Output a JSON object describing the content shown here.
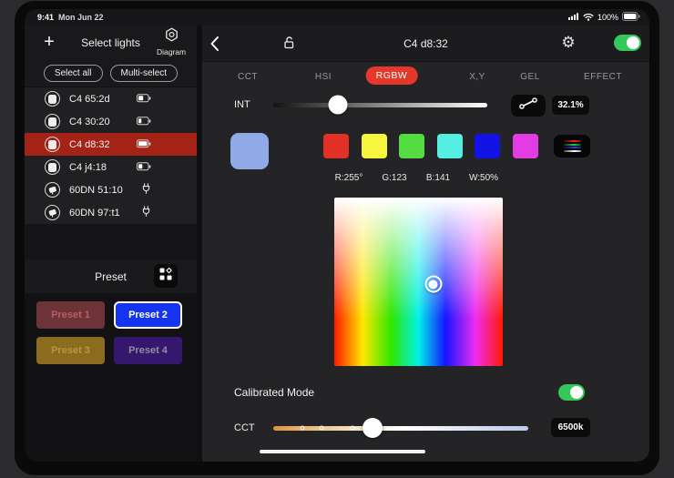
{
  "status_bar": {
    "time": "9:41",
    "date": "Mon Jun 22",
    "battery": "100%"
  },
  "icons": {
    "gear": "⚙",
    "plus": "+"
  },
  "sidebar": {
    "title": "Select lights",
    "diagram_label": "Diagram",
    "select_all": "Select all",
    "multi_select": "Multi-select",
    "lights": [
      {
        "name": "C4 65:2d",
        "type": "panel",
        "power": "battery",
        "battery_level": 55,
        "selected": false
      },
      {
        "name": "C4 30:20",
        "type": "panel",
        "power": "battery",
        "battery_level": 35,
        "selected": false
      },
      {
        "name": "C4 d8:32",
        "type": "panel",
        "power": "battery",
        "battery_level": 100,
        "selected": true
      },
      {
        "name": "C4 j4:18",
        "type": "panel",
        "power": "battery",
        "battery_level": 45,
        "selected": false
      },
      {
        "name": "60DN 51:10",
        "type": "monolight",
        "power": "ac",
        "selected": false
      },
      {
        "name": "60DN 97:t1",
        "type": "monolight",
        "power": "ac",
        "selected": false
      }
    ],
    "preset_title": "Preset",
    "presets": [
      {
        "label": "Preset 1",
        "bg": "#6e3338",
        "fg": "#b35f63",
        "selected": false
      },
      {
        "label": "Preset 2",
        "bg": "#1434f2",
        "fg": "#ffffff",
        "selected": true
      },
      {
        "label": "Preset 3",
        "bg": "#8a6b1f",
        "fg": "#bb973a",
        "selected": false
      },
      {
        "label": "Preset 4",
        "bg": "#35186e",
        "fg": "#8e8e9e",
        "selected": false
      }
    ]
  },
  "header": {
    "title": "C4 d8:32",
    "power_on": true
  },
  "tabs": [
    {
      "label": "CCT",
      "selected": false
    },
    {
      "label": "HSI",
      "selected": false
    },
    {
      "label": "RGBW",
      "selected": true
    },
    {
      "label": "X,Y",
      "selected": false
    },
    {
      "label": "GEL",
      "selected": false
    },
    {
      "label": "EFFECT",
      "selected": false
    }
  ],
  "intensity": {
    "label": "INT",
    "value": "32.1%",
    "percent": 30
  },
  "rgbw": {
    "current_color": "#90a9e7",
    "swatches": [
      "#e23227",
      "#f6f63e",
      "#55dc43",
      "#55eee2",
      "#1212e6",
      "#e23ce2"
    ],
    "channels": [
      "R:255°",
      "G:123",
      "B:141",
      "W:50%"
    ],
    "picker_cursor": {
      "x_percent": 58.9,
      "y_percent": 51.4
    }
  },
  "calibrated_mode": {
    "label": "Calibrated Mode",
    "enabled": true
  },
  "cct": {
    "label": "CCT",
    "value": "6500k",
    "percent": 39,
    "marker_percents": [
      11.3,
      19,
      31.2
    ]
  },
  "colors": {
    "accent_red": "#e3382a",
    "toggle_green": "#34c759",
    "selected_row_red": "#a32417"
  }
}
